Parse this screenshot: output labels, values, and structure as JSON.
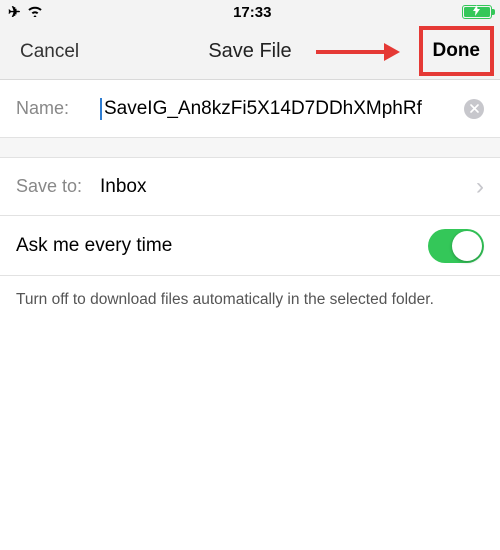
{
  "status": {
    "time": "17:33"
  },
  "nav": {
    "cancel": "Cancel",
    "title": "Save File",
    "done": "Done"
  },
  "form": {
    "name_label": "Name:",
    "name_value": "SaveIG_An8kzFi5X14D7DDhXMphRf",
    "saveto_label": "Save to:",
    "saveto_value": "Inbox",
    "toggle_label": "Ask me every time",
    "toggle_on": true,
    "footer": "Turn off to download files automatically in the selected folder."
  }
}
